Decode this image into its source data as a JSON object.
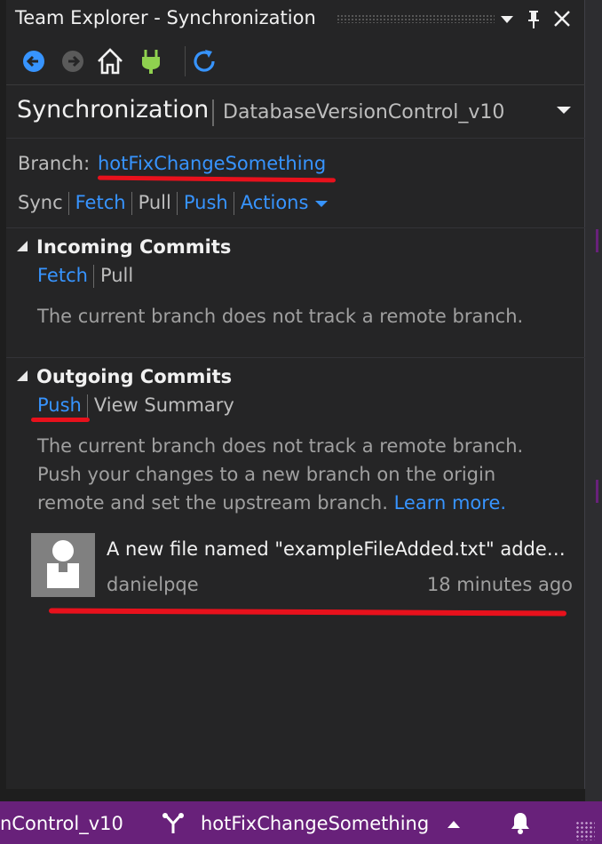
{
  "window": {
    "title": "Team Explorer - Synchronization",
    "dropdown_icon": "chevron-down-icon",
    "pin_icon": "pin-icon",
    "close_icon": "close-icon"
  },
  "toolbar": {
    "icons": [
      "back-icon",
      "forward-icon",
      "home-icon",
      "connect-plug-icon",
      "refresh-icon"
    ]
  },
  "page": {
    "title": "Synchronization",
    "repo": "DatabaseVersionControl_v10"
  },
  "branch": {
    "label": "Branch:",
    "name": "hotFixChangeSomething"
  },
  "sync_links": {
    "sync": "Sync",
    "fetch": "Fetch",
    "pull": "Pull",
    "push": "Push",
    "actions": "Actions"
  },
  "incoming": {
    "header": "Incoming Commits",
    "fetch": "Fetch",
    "pull": "Pull",
    "message": "The current branch does not track a remote branch."
  },
  "outgoing": {
    "header": "Outgoing Commits",
    "push": "Push",
    "view_summary": "View Summary",
    "message_line1": "The current branch does not track a remote branch.",
    "message_line2": "Push your changes to a new branch on the origin",
    "message_line3": "remote and set the upstream branch.",
    "learn_more": "Learn more.",
    "commits": [
      {
        "title": "A new file named \"exampleFileAdded.txt\" added to repository",
        "author": "danielpqe",
        "time": "18 minutes ago"
      }
    ]
  },
  "statusbar": {
    "repo": "nControl_v10",
    "branch": "hotFixChangeSomething",
    "bell_icon": "bell-icon"
  },
  "colors": {
    "link": "#3794ff",
    "statusbar": "#68217a",
    "annotation": "#e8111c"
  }
}
